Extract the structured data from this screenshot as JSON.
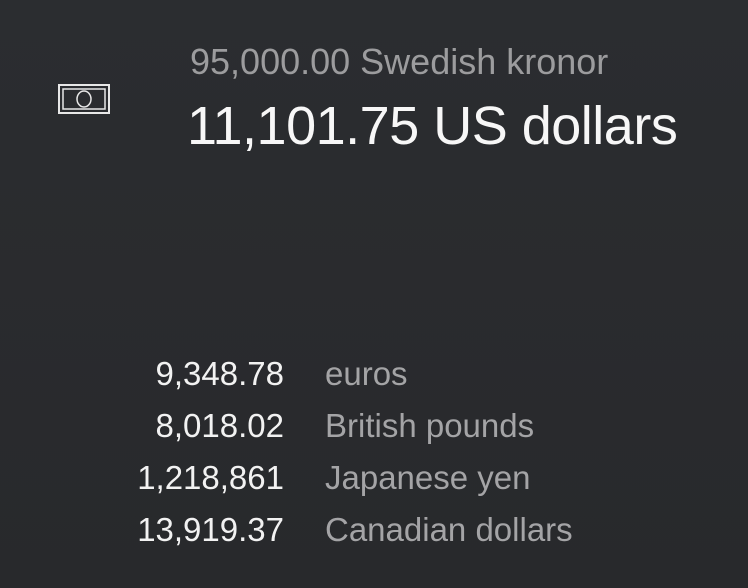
{
  "icon": {
    "name": "banknote-icon"
  },
  "conversion": {
    "source": "95,000.00 Swedish kronor",
    "result": "11,101.75 US dollars"
  },
  "other_currencies": [
    {
      "amount": "9,348.78",
      "name": "euros"
    },
    {
      "amount": "8,018.02",
      "name": "British pounds"
    },
    {
      "amount": "1,218,861",
      "name": "Japanese yen"
    },
    {
      "amount": "13,919.37",
      "name": "Canadian dollars"
    }
  ],
  "colors": {
    "background": "#292b2e",
    "primary_text": "#f7f7f7",
    "secondary_text": "#9c9c9e"
  }
}
